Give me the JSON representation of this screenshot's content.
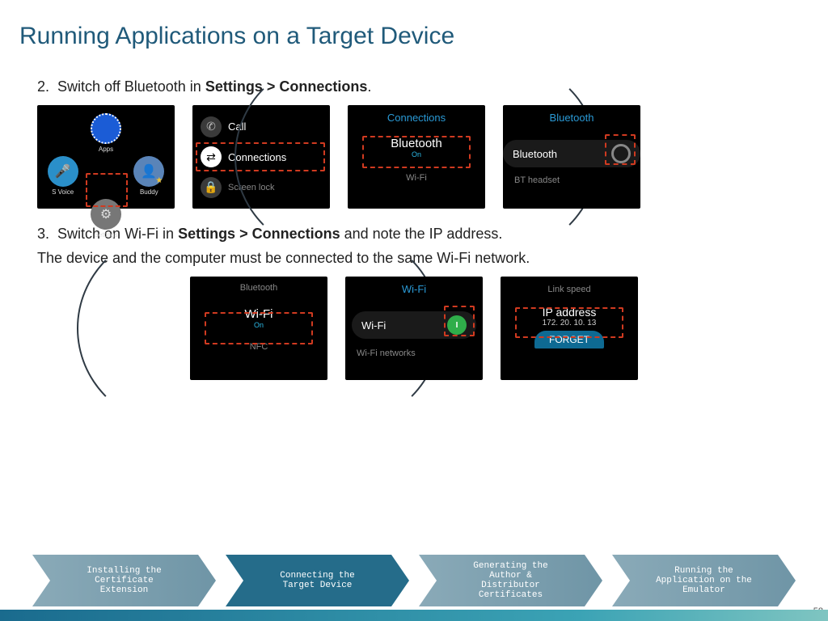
{
  "title": "Running Applications on a Target Device",
  "step2": {
    "num": "2.",
    "pre": "Switch off Bluetooth in ",
    "bold": "Settings > Connections",
    "post": "."
  },
  "step3": {
    "num": "3.",
    "pre": "Switch on Wi-Fi in ",
    "bold": "Settings > Connections",
    "post": " and note the IP address.",
    "line2": "The device and the computer must be connected to the same Wi-Fi network."
  },
  "shot1": {
    "apps": "Apps",
    "svoice": "S Voice",
    "buddy": "Buddy",
    "settings": "Settings"
  },
  "shot2": {
    "call": "Call",
    "connections": "Connections",
    "screenlock": "Screen lock"
  },
  "shot3": {
    "header": "Connections",
    "bluetooth": "Bluetooth",
    "on": "On",
    "wifi": "Wi-Fi"
  },
  "shot4": {
    "header": "Bluetooth",
    "bluetooth": "Bluetooth",
    "bt_headset": "BT headset"
  },
  "shot5": {
    "bluetooth": "Bluetooth",
    "wifi": "Wi-Fi",
    "on": "On",
    "nfc": "NFC"
  },
  "shot6": {
    "header": "Wi-Fi",
    "wifi": "Wi-Fi",
    "networks": "Wi-Fi networks"
  },
  "shot7": {
    "linkspeed": "Link speed",
    "ip_label": "IP address",
    "ip_value": "172. 20. 10. 13",
    "forget": "FORGET"
  },
  "process": {
    "p1": "Installing the\nCertificate\nExtension",
    "p2": "Connecting the\nTarget Device",
    "p3": "Generating the\nAuthor &\nDistributor\nCertificates",
    "p4": "Running the\nApplication on the\nEmulator"
  },
  "page_number": "58"
}
